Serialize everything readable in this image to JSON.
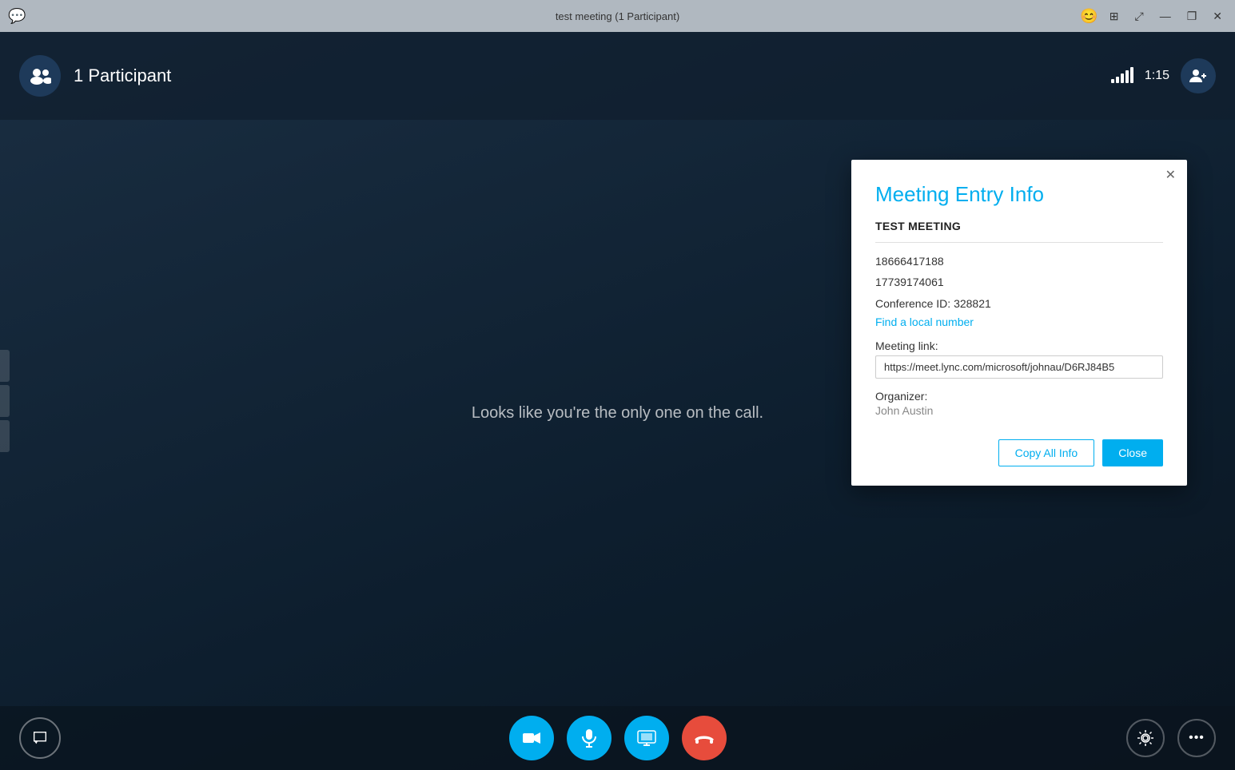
{
  "titlebar": {
    "title": "test meeting (1 Participant)",
    "emoji_icon": "😊",
    "minimize": "—",
    "restore": "❐",
    "close": "✕"
  },
  "header": {
    "participant_count": "1 Participant",
    "signal_bars": [
      4,
      8,
      12,
      16,
      20
    ],
    "time": "1:15",
    "add_user_symbol": "👤+"
  },
  "main": {
    "empty_message": "Looks like you're the only one on the call."
  },
  "dialog": {
    "title": "Meeting Entry Info",
    "meeting_name": "TEST MEETING",
    "phone1": "18666417188",
    "phone2": "17739174061",
    "conference_id_label": "Conference ID:",
    "conference_id": "328821",
    "find_local": "Find a local number",
    "meeting_link_label": "Meeting link:",
    "meeting_link": "https://meet.lync.com/microsoft/johnau/D6RJ84B5",
    "organizer_label": "Organizer:",
    "organizer_name": "John Austin",
    "copy_btn": "Copy All Info",
    "close_btn": "Close"
  },
  "toolbar": {
    "video_icon": "📹",
    "mic_icon": "🎤",
    "screen_icon": "🖥",
    "hangup_icon": "📞",
    "chat_icon": "💬",
    "settings_icon": "⚙",
    "more_icon": "···"
  }
}
